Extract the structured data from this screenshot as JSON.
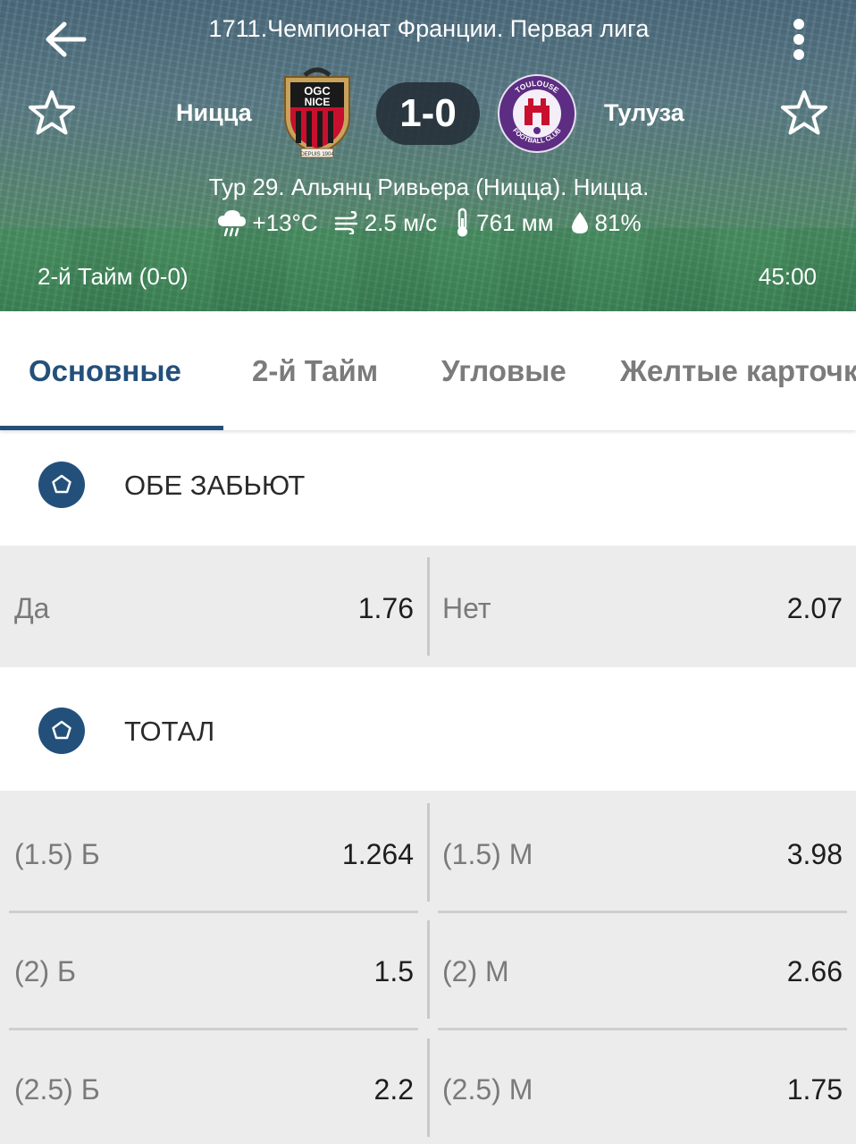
{
  "header": {
    "league": "1711.Чемпионат Франции. Первая лига",
    "home_team": "Ницца",
    "away_team": "Тулуза",
    "score": "1-0",
    "venue": "Тур 29. Альянц Ривьера (Ницца). Ницца.",
    "weather": {
      "temperature": "+13°C",
      "wind": "2.5 м/с",
      "pressure": "761 мм",
      "humidity": "81%"
    },
    "period": "2-й  Тайм (0-0)",
    "timer": "45:00",
    "home_logo": {
      "line1": "OGC",
      "line2": "NICE",
      "line3": "DEPUIS 1904"
    },
    "away_logo": {
      "top": "TOULOUSE",
      "bottom": "FOOTBALL CLUB"
    }
  },
  "tabs": [
    {
      "label": "Основные",
      "active": true
    },
    {
      "label": "2-й  Тайм",
      "active": false
    },
    {
      "label": "Угловые",
      "active": false
    },
    {
      "label": "Желтые карточки",
      "active": false
    }
  ],
  "markets": [
    {
      "title": "ОБЕ ЗАБЬЮТ",
      "rows": [
        {
          "left_label": "Да",
          "left_odd": "1.76",
          "right_label": "Нет",
          "right_odd": "2.07"
        }
      ]
    },
    {
      "title": "ТОТАЛ",
      "rows": [
        {
          "left_label": "(1.5) Б",
          "left_odd": "1.264",
          "right_label": "(1.5) М",
          "right_odd": "3.98"
        },
        {
          "left_label": "(2) Б",
          "left_odd": "1.5",
          "right_label": "(2) М",
          "right_odd": "2.66"
        },
        {
          "left_label": "(2.5) Б",
          "left_odd": "2.2",
          "right_label": "(2.5) М",
          "right_odd": "1.75"
        }
      ]
    }
  ],
  "colors": {
    "accent": "#23507b",
    "ball": "#23507b",
    "row_bg": "#ececec"
  }
}
